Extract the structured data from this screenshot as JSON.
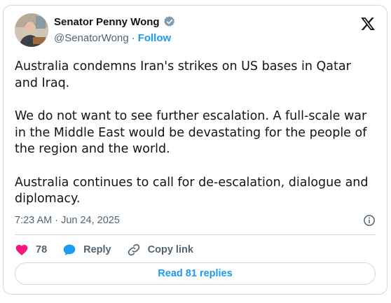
{
  "author": {
    "name": "Senator Penny Wong",
    "handle": "@SenatorWong",
    "separator": "·",
    "follow_label": "Follow",
    "verified_color": "#829aab"
  },
  "tweet": {
    "paragraphs": [
      "Australia condemns Iran's strikes on US bases in Qatar and Iraq.",
      "We do not want to see further escalation. A full-scale war in the Middle East would be devastating for the people of the region and the world.",
      "Australia continues to call for de-escalation, dialogue and diplomacy."
    ],
    "timestamp": "7:23 AM · Jun 24, 2025"
  },
  "actions": {
    "likes_count": "78",
    "reply_label": "Reply",
    "copy_link_label": "Copy link"
  },
  "replies": {
    "label": "Read 81 replies"
  },
  "icons": {
    "logo": "x-logo-icon",
    "verified": "verified-badge-icon",
    "info": "info-icon",
    "like": "heart-icon",
    "reply": "speech-bubble-icon",
    "copy": "link-icon"
  },
  "colors": {
    "accent": "#1d9bf0",
    "like": "#f91880",
    "muted": "#536471",
    "border": "#cfd9de"
  }
}
